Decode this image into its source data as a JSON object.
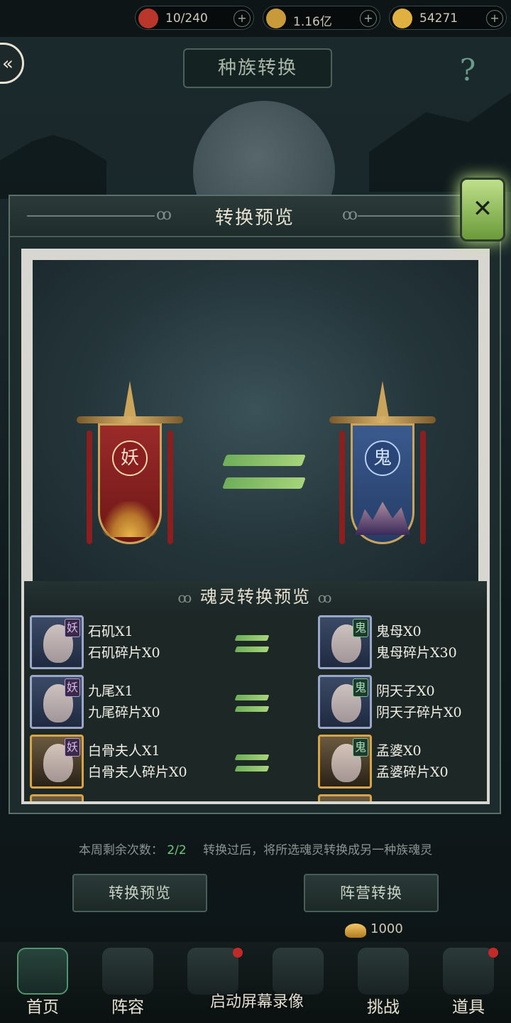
{
  "topbar": {
    "resources": [
      {
        "icon": "bag-icon",
        "value": "10/240",
        "color": "#b8372a"
      },
      {
        "icon": "coin-icon",
        "value": "1.16亿",
        "color": "#c89a3a"
      },
      {
        "icon": "gold-ingot-icon",
        "value": "54271",
        "color": "#e0b040"
      }
    ],
    "plus": "+"
  },
  "header": {
    "back_symbol": "«",
    "title": "种族转换",
    "help_symbol": "?"
  },
  "modal": {
    "title": "转换预览",
    "close_symbol": "✕",
    "swirl": "ꝏ",
    "from_race": "妖",
    "to_race": "鬼",
    "list_title": "魂灵转换预览",
    "rows": [
      {
        "from_tag": "妖",
        "from_name": "石矶X1",
        "from_shard": "石矶碎片X0",
        "to_tag": "鬼",
        "to_name": "鬼母X0",
        "to_shard": "鬼母碎片X30"
      },
      {
        "from_tag": "妖",
        "from_name": "九尾X1",
        "from_shard": "九尾碎片X0",
        "to_tag": "鬼",
        "to_name": "阴天子X0",
        "to_shard": "阴天子碎片X0"
      },
      {
        "from_tag": "妖",
        "from_name": "白骨夫人X1",
        "from_shard": "白骨夫人碎片X0",
        "to_tag": "鬼",
        "to_name": "孟婆X0",
        "to_shard": "孟婆碎片X0"
      }
    ]
  },
  "info": {
    "prefix": "本周剩余次数：",
    "count": "2/2",
    "suffix": "转换过后，将所选魂灵转换成另一种族魂灵"
  },
  "buttons": {
    "preview": "转换预览",
    "convert": "阵营转换",
    "cost": "1000"
  },
  "nav": {
    "items": [
      "首页",
      "阵容",
      "",
      "",
      "挑战",
      "道具"
    ],
    "overlay": "启动屏幕录像"
  }
}
